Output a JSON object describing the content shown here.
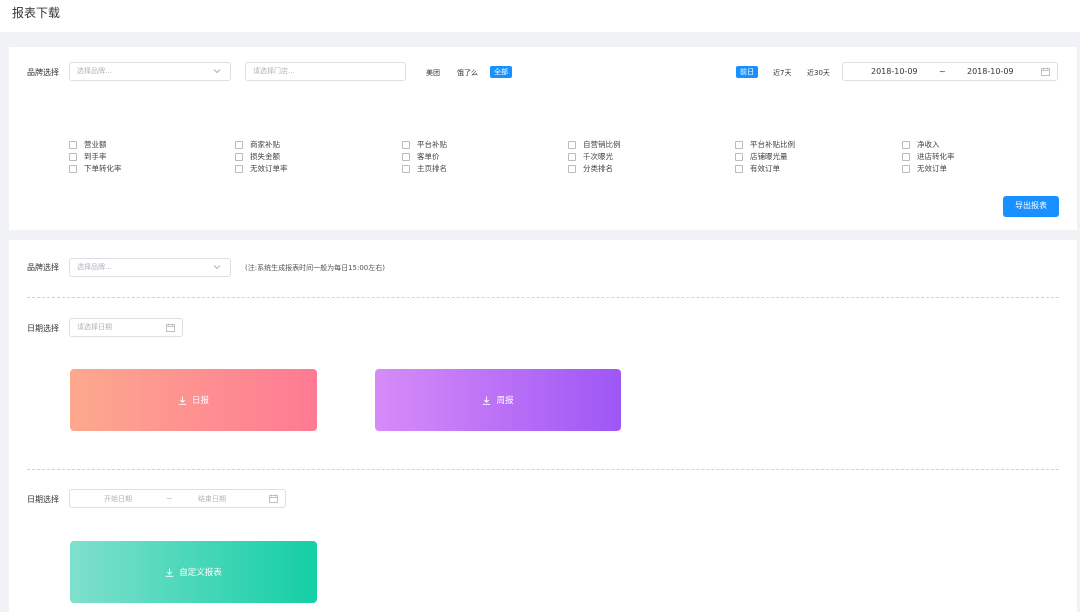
{
  "page": {
    "title": "报表下载"
  },
  "filters": {
    "brand_label": "品牌选择",
    "brand_placeholder": "选择品牌...",
    "store_placeholder": "请选择门店...",
    "platforms": [
      "美团",
      "饿了么",
      "全部"
    ],
    "selected_platform": "全部",
    "ranges": [
      "前日",
      "近7天",
      "近30天"
    ],
    "selected_range": "前日",
    "date_start": "2018-10-09",
    "date_sep": "~",
    "date_end": "2018-10-09"
  },
  "metrics": {
    "columns": [
      [
        "营业额",
        "到手率",
        "下单转化率"
      ],
      [
        "商家补贴",
        "损失金额",
        "无效订单率"
      ],
      [
        "平台补贴",
        "客单价",
        "主页排名"
      ],
      [
        "自营销比例",
        "千次曝光",
        "分类排名"
      ],
      [
        "平台补贴比例",
        "店铺曝光量",
        "有效订单"
      ],
      [
        "净收入",
        "进店转化率",
        "无效订单"
      ]
    ]
  },
  "export": {
    "label": "导出报表"
  },
  "download": {
    "brand_label": "品牌选择",
    "brand_placeholder": "选择品牌...",
    "note": "(注:系统生成报表时间一般为每日15:00左右)",
    "date_label": "日期选择",
    "date_placeholder": "请选择日期",
    "daily_label": "日报",
    "weekly_label": "周报",
    "range_label": "日期选择",
    "range_start_placeholder": "开始日期",
    "range_sep": "~",
    "range_end_placeholder": "结束日期",
    "custom_label": "自定义报表"
  },
  "colors": {
    "primary": "#1890ff"
  }
}
